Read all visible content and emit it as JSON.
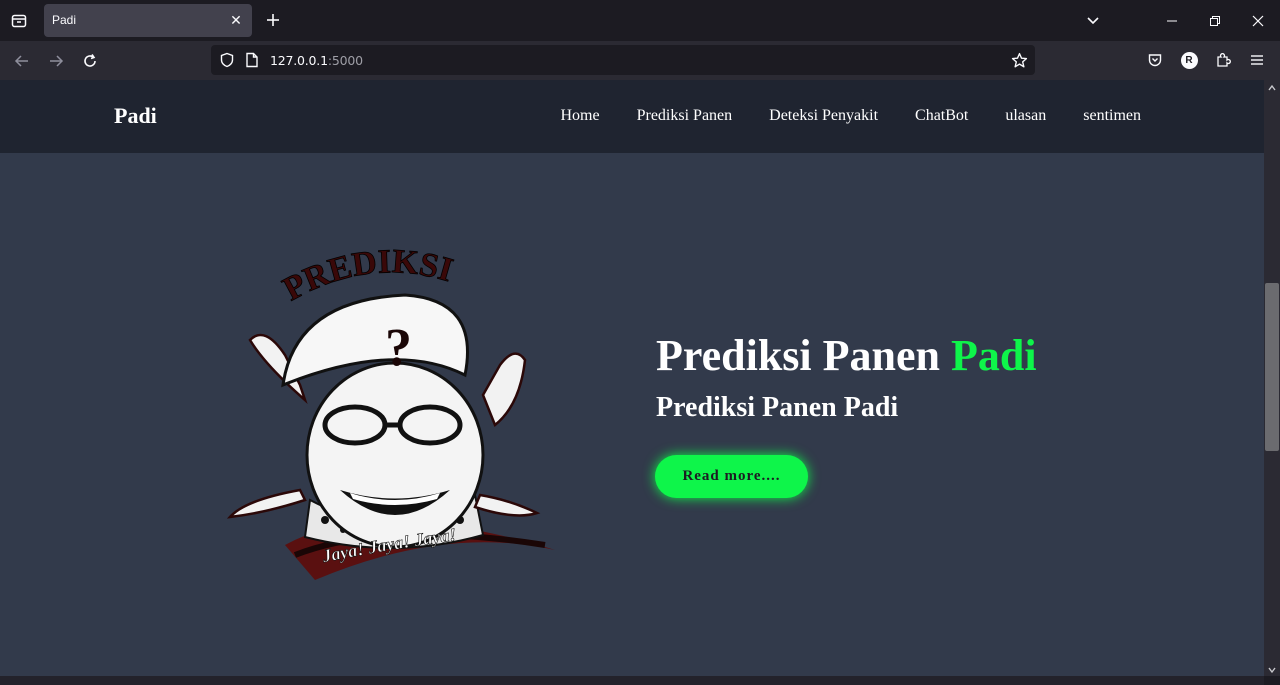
{
  "browser": {
    "tab_title": "Padi",
    "url_host": "127.0.0.1",
    "url_port": ":5000",
    "profile_initial": "R"
  },
  "site": {
    "logo": "Padi",
    "nav": [
      "Home",
      "Prediksi Panen",
      "Deteksi Penyakit",
      "ChatBot",
      "ulasan",
      "sentimen"
    ],
    "hero": {
      "title_main": "Prediksi Panen",
      "title_accent": "Padi",
      "subtitle": "Prediksi Panen Padi",
      "button": "Read more....",
      "image_text_top": "PREDIKSI",
      "image_text_bottom": "Jaya! Jaya! Jaya!"
    }
  },
  "colors": {
    "accent": "#0ef54a",
    "page_bg": "#323a4b",
    "header_bg": "#1f2430",
    "chrome_bg": "#1c1b22"
  }
}
